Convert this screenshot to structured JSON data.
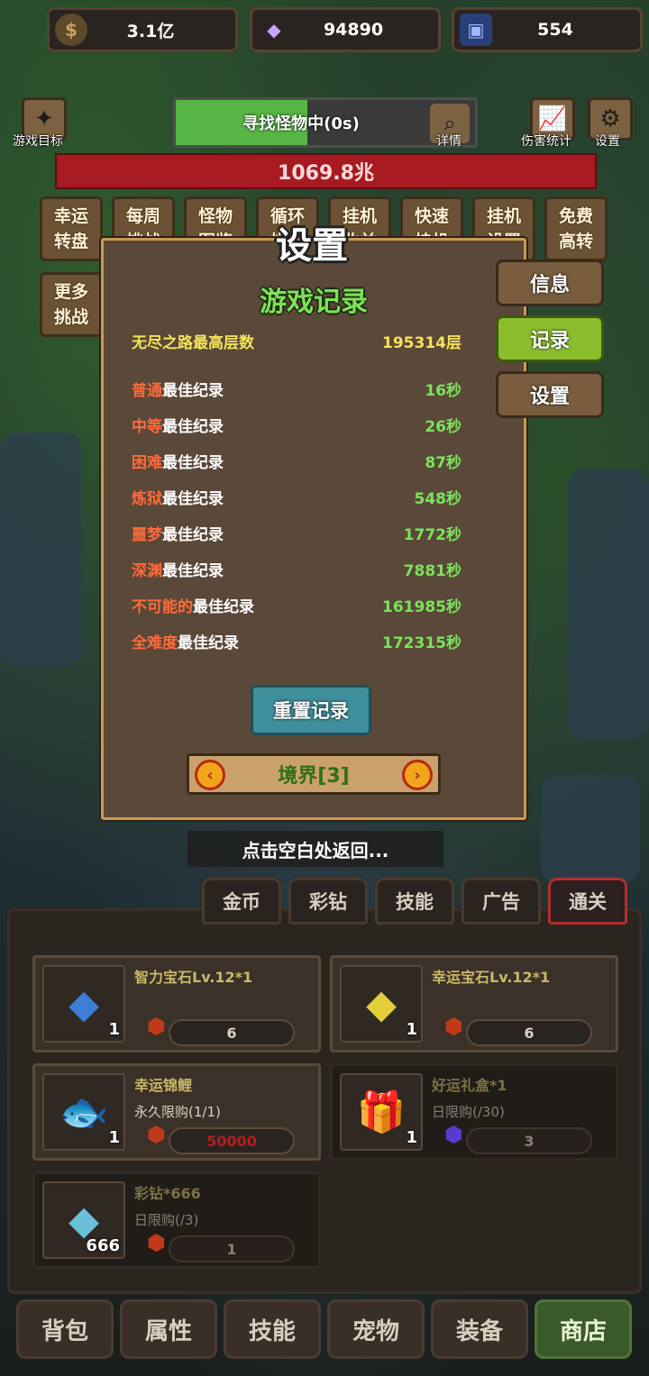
{
  "resources": {
    "gold": "3.1亿",
    "crystal": "94890",
    "cards": "554"
  },
  "top": {
    "goal_label": "游戏目标",
    "search_text": "寻找怪物中(0s)",
    "search_progress": 0.44,
    "detail_label": "详情",
    "damage_label": "伤害统计",
    "settings_label": "设置",
    "boss_hp": "1069.8兆"
  },
  "features": [
    {
      "label": "幸运\n转盘"
    },
    {
      "label": "每周\n挑战"
    },
    {
      "label": "怪物\n图鉴"
    },
    {
      "label": "循环\n挑战"
    },
    {
      "label": "挂机\n收益"
    },
    {
      "label": "快速\n挂机"
    },
    {
      "label": "挂机\n设置"
    },
    {
      "label": "免费\n高转"
    },
    {
      "label": "更多\n挑战"
    }
  ],
  "modal": {
    "title": "设置",
    "section_title": "游戏记录",
    "tabs": [
      {
        "label": "信息",
        "active": false
      },
      {
        "label": "记录",
        "active": true
      },
      {
        "label": "设置",
        "active": false
      }
    ],
    "endless": {
      "label": "无尽之路最高层数",
      "value": "195314层"
    },
    "records": [
      {
        "diff": "普通",
        "suffix": "最佳纪录",
        "value": "16秒"
      },
      {
        "diff": "中等",
        "suffix": "最佳纪录",
        "value": "26秒"
      },
      {
        "diff": "困难",
        "suffix": "最佳纪录",
        "value": "87秒"
      },
      {
        "diff": "炼狱",
        "suffix": "最佳纪录",
        "value": "548秒"
      },
      {
        "diff": "噩梦",
        "suffix": "最佳纪录",
        "value": "1772秒"
      },
      {
        "diff": "深渊",
        "suffix": "最佳纪录",
        "value": "7881秒"
      },
      {
        "diff": "不可能的",
        "suffix": "最佳纪录",
        "value": "161985秒"
      },
      {
        "diff": "全难度",
        "suffix": "最佳纪录",
        "value": "172315秒"
      }
    ],
    "reset_label": "重置记录",
    "realm_label": "境界[3]",
    "close_hint": "点击空白处返回..."
  },
  "shop": {
    "tabs": [
      {
        "label": "金币",
        "active": false
      },
      {
        "label": "彩钻",
        "active": false
      },
      {
        "label": "技能",
        "active": false
      },
      {
        "label": "广告",
        "active": false
      },
      {
        "label": "通关",
        "active": true
      }
    ],
    "items": [
      {
        "name": "智力宝石Lv.12*1",
        "limit": "",
        "limit_used": "",
        "limit_total": "",
        "price": "6",
        "qty": "1",
        "icon": "blue-gem-icon"
      },
      {
        "name": "幸运宝石Lv.12*1",
        "limit": "",
        "limit_used": "",
        "limit_total": "",
        "price": "6",
        "qty": "1",
        "icon": "yellow-gem-icon"
      },
      {
        "name": "幸运锦鲤",
        "limit": "永久限购(1/1)",
        "limit_used": "",
        "limit_total": "",
        "price": "50000",
        "qty": "1",
        "icon": "koi-icon"
      },
      {
        "name": "好运礼盒*1",
        "limit": "日限购(",
        "limit_used": "",
        "limit_total": "/30)",
        "price": "3",
        "qty": "1",
        "icon": "gift-box-icon"
      },
      {
        "name": "彩钻*666",
        "limit": "日限购(",
        "limit_used": "",
        "limit_total": "/3)",
        "price": "1",
        "qty": "666",
        "icon": "crystal-icon"
      }
    ]
  },
  "nav": [
    {
      "label": "背包",
      "active": false
    },
    {
      "label": "属性",
      "active": false
    },
    {
      "label": "技能",
      "active": false
    },
    {
      "label": "宠物",
      "active": false
    },
    {
      "label": "装备",
      "active": false
    },
    {
      "label": "商店",
      "active": true
    }
  ],
  "colors": {
    "accent_green": "#7ee05a",
    "difficulty_orange": "#ff6a3a",
    "endless_yellow": "#f4e35a",
    "boss_red": "#a71a22"
  }
}
